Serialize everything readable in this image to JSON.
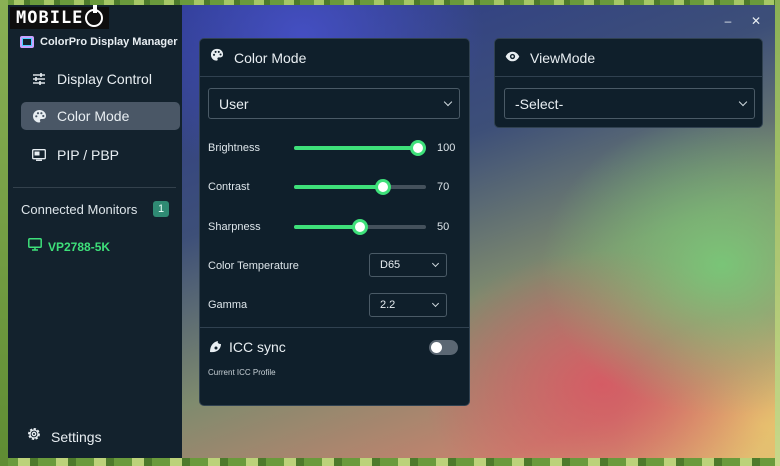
{
  "watermark": {
    "brand": "MOBILE"
  },
  "app": {
    "title": "ColorPro Display Manager"
  },
  "window_controls": {
    "minimize": "–",
    "close": "✕"
  },
  "sidebar": {
    "items": [
      {
        "label": "Display Control",
        "icon": "sliders-icon",
        "active": false
      },
      {
        "label": "Color Mode",
        "icon": "palette-icon",
        "active": true
      },
      {
        "label": "PIP / PBP",
        "icon": "pip-icon",
        "active": false
      }
    ],
    "connected_monitors_label": "Connected Monitors",
    "monitor_count": "1",
    "monitors": [
      {
        "name": "VP2788-5K"
      }
    ],
    "settings_label": "Settings"
  },
  "color_mode_card": {
    "title": "Color Mode",
    "mode_select": {
      "value": "User"
    },
    "sliders": [
      {
        "label": "Brightness",
        "value": 100,
        "value_text": "100",
        "min": 0,
        "max": 100
      },
      {
        "label": "Contrast",
        "value": 70,
        "value_text": "70",
        "min": 0,
        "max": 100
      },
      {
        "label": "Sharpness",
        "value": 50,
        "value_text": "50",
        "min": 0,
        "max": 100
      }
    ],
    "color_temperature": {
      "label": "Color Temperature",
      "value": "D65"
    },
    "gamma": {
      "label": "Gamma",
      "value": "2.2"
    },
    "icc_sync": {
      "label": "ICC sync",
      "enabled": false
    },
    "current_icc_profile_label": "Current ICC Profile"
  },
  "view_mode_card": {
    "title": "ViewMode",
    "select": {
      "value": "-Select-"
    }
  },
  "colors": {
    "accent_green": "#3ee07a",
    "sidebar_bg": "#13222d",
    "card_bg": "#0f1f2b",
    "active_item_bg": "#4a5766"
  }
}
